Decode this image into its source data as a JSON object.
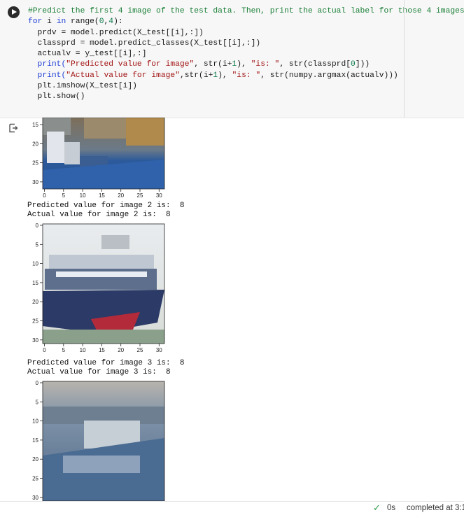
{
  "code_cell": {
    "lines": [
      [
        {
          "t": "#Predict the first 4 image of the test data. Then, print the actual label for those 4 images",
          "c": "comment"
        }
      ],
      [
        {
          "t": "for",
          "c": "kw"
        },
        {
          "t": " i "
        },
        {
          "t": "in",
          "c": "kw"
        },
        {
          "t": " range("
        },
        {
          "t": "0",
          "c": "num"
        },
        {
          "t": ","
        },
        {
          "t": "4",
          "c": "num"
        },
        {
          "t": "):"
        }
      ],
      [
        {
          "t": "  prdv = model.predict(X_test[[i],:])"
        }
      ],
      [
        {
          "t": "  classprd = model.predict_classes(X_test[[i],:])"
        }
      ],
      [
        {
          "t": "  actualv = y_test[[i],:]"
        }
      ],
      [
        {
          "t": "  print(",
          "c": "kw"
        },
        {
          "t": "\"Predicted value for image\"",
          "c": "str"
        },
        {
          "t": ", str(i+"
        },
        {
          "t": "1",
          "c": "num"
        },
        {
          "t": "), "
        },
        {
          "t": "\"is: \"",
          "c": "str"
        },
        {
          "t": ", str(classprd["
        },
        {
          "t": "0",
          "c": "num"
        },
        {
          "t": "]))"
        }
      ],
      [
        {
          "t": "  print(",
          "c": "kw"
        },
        {
          "t": "\"Actual value for image\"",
          "c": "str"
        },
        {
          "t": ",str(i+"
        },
        {
          "t": "1",
          "c": "num"
        },
        {
          "t": "), "
        },
        {
          "t": "\"is: \"",
          "c": "str"
        },
        {
          "t": ", str(numpy.argmax(actualv)))"
        }
      ],
      [
        {
          "t": "  plt.imshow(X_test[i])"
        }
      ],
      [
        {
          "t": "  plt.show()"
        }
      ]
    ]
  },
  "output": {
    "axis_ticks_x": [
      "0",
      "5",
      "10",
      "15",
      "20",
      "25",
      "30"
    ],
    "axis_ticks_y_full": [
      "0",
      "5",
      "10",
      "15",
      "20",
      "25",
      "30"
    ],
    "axis_ticks_y_partial": [
      "15",
      "20",
      "25",
      "30"
    ],
    "blocks": [
      {
        "predicted": "Predicted value for image 2 is:  8",
        "actual": "Actual value for image 2 is:  8"
      },
      {
        "predicted": "Predicted value for image 3 is:  8",
        "actual": "Actual value for image 3 is:  8"
      }
    ]
  },
  "status_bar": {
    "check_icon": "check-icon",
    "duration": "0s",
    "completed": "completed at 3:1"
  }
}
